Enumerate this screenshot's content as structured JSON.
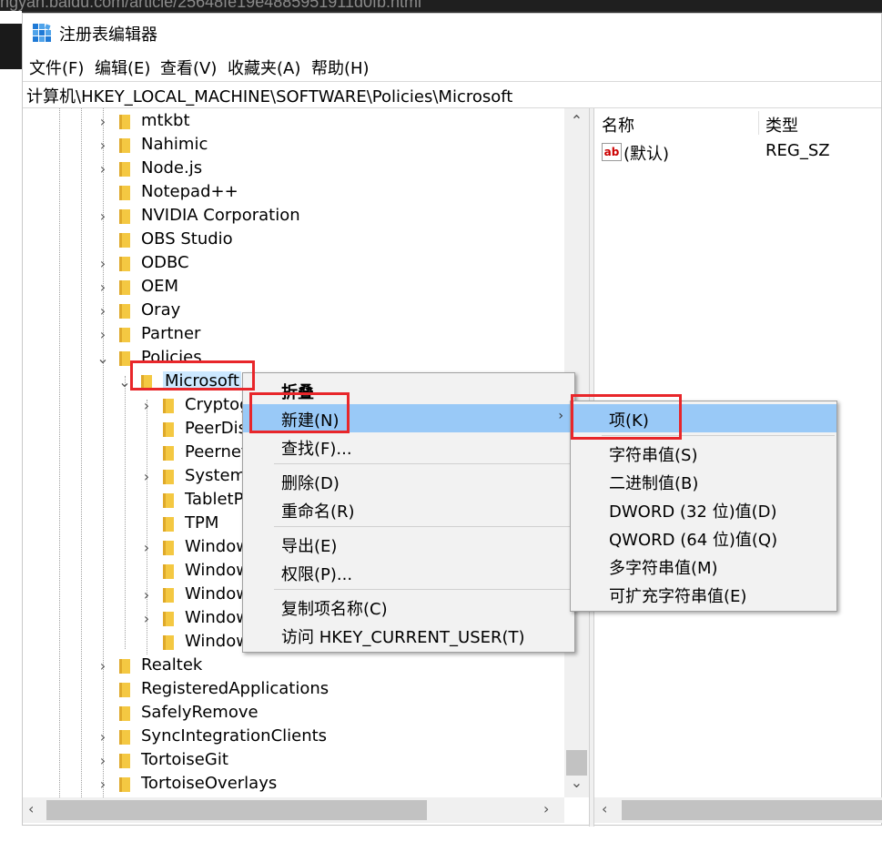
{
  "background": {
    "url_fragment": "ngyan.baidu.com/article/25648fe19e4885951911d0fb.html"
  },
  "window": {
    "title": "注册表编辑器",
    "menu": [
      "文件(F)",
      "编辑(E)",
      "查看(V)",
      "收藏夹(A)",
      "帮助(H)"
    ],
    "address": "计算机\\HKEY_LOCAL_MACHINE\\SOFTWARE\\Policies\\Microsoft"
  },
  "tree": {
    "items": [
      {
        "label": "mtkbt",
        "expander": "collapsed"
      },
      {
        "label": "Nahimic",
        "expander": "collapsed"
      },
      {
        "label": "Node.js",
        "expander": "collapsed"
      },
      {
        "label": "Notepad++",
        "expander": "none"
      },
      {
        "label": "NVIDIA Corporation",
        "expander": "collapsed"
      },
      {
        "label": "OBS Studio",
        "expander": "none"
      },
      {
        "label": "ODBC",
        "expander": "collapsed"
      },
      {
        "label": "OEM",
        "expander": "collapsed"
      },
      {
        "label": "Oray",
        "expander": "collapsed"
      },
      {
        "label": "Partner",
        "expander": "collapsed"
      },
      {
        "label": "Policies",
        "expander": "expanded"
      },
      {
        "label": "Microsoft",
        "expander": "expanded",
        "selected": true
      },
      {
        "label": "Cryptography",
        "expander": "collapsed"
      },
      {
        "label": "PeerDist",
        "expander": "none"
      },
      {
        "label": "Peernet",
        "expander": "none"
      },
      {
        "label": "SystemCertificates",
        "expander": "collapsed"
      },
      {
        "label": "TabletPC",
        "expander": "none"
      },
      {
        "label": "TPM",
        "expander": "none"
      },
      {
        "label": "Windows",
        "expander": "collapsed"
      },
      {
        "label": "Windows",
        "expander": "none"
      },
      {
        "label": "Windows",
        "expander": "collapsed"
      },
      {
        "label": "Windows",
        "expander": "collapsed"
      },
      {
        "label": "Windows",
        "expander": "none"
      },
      {
        "label": "Realtek",
        "expander": "collapsed"
      },
      {
        "label": "RegisteredApplications",
        "expander": "none"
      },
      {
        "label": "SafelyRemove",
        "expander": "none"
      },
      {
        "label": "SyncIntegrationClients",
        "expander": "collapsed"
      },
      {
        "label": "TortoiseGit",
        "expander": "collapsed"
      },
      {
        "label": "TortoiseOverlays",
        "expander": "collapsed"
      }
    ]
  },
  "values_pane": {
    "col_name": "名称",
    "col_type": "类型",
    "rows": [
      {
        "icon": "string-value-icon",
        "icon_text": "ab",
        "name": "(默认)",
        "type": "REG_SZ"
      }
    ]
  },
  "context_menu": {
    "items": [
      {
        "label": "折叠",
        "bold": true
      },
      {
        "label": "新建(N)",
        "highlighted": true,
        "submenu_arrow": "›"
      },
      {
        "label": "查找(F)..."
      },
      {
        "separator": true
      },
      {
        "label": "删除(D)"
      },
      {
        "label": "重命名(R)"
      },
      {
        "separator": true
      },
      {
        "label": "导出(E)"
      },
      {
        "label": "权限(P)..."
      },
      {
        "separator": true
      },
      {
        "label": "复制项名称(C)"
      },
      {
        "label": "访问 HKEY_CURRENT_USER(T)"
      }
    ]
  },
  "submenu": {
    "items": [
      {
        "label": "项(K)",
        "highlighted": true
      },
      {
        "separator": true
      },
      {
        "label": "字符串值(S)"
      },
      {
        "label": "二进制值(B)"
      },
      {
        "label": "DWORD (32 位)值(D)"
      },
      {
        "label": "QWORD (64 位)值(Q)"
      },
      {
        "label": "多字符串值(M)"
      },
      {
        "label": "可扩充字符串值(E)"
      }
    ]
  },
  "scrollbars": {
    "up": "⌃",
    "down": "⌄",
    "left": "‹",
    "right": "›"
  },
  "colors": {
    "highlight": "#99c9f7",
    "annotation_red": "#e8262a",
    "folder": "#f4c842"
  }
}
